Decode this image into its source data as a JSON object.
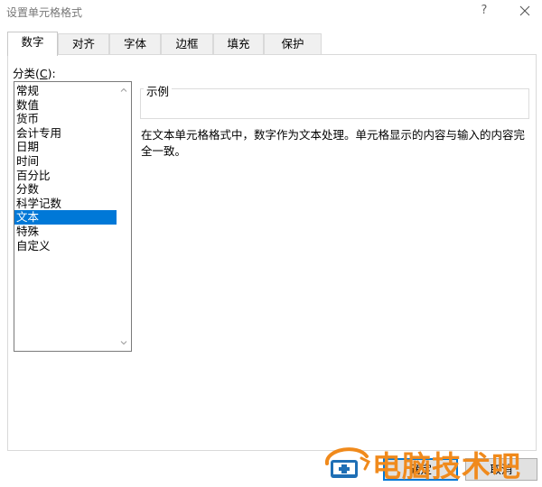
{
  "dialog": {
    "title": "设置单元格格式",
    "help_label": "?",
    "tabs": [
      {
        "label": "数字",
        "active": true
      },
      {
        "label": "对齐",
        "active": false
      },
      {
        "label": "字体",
        "active": false
      },
      {
        "label": "边框",
        "active": false
      },
      {
        "label": "填充",
        "active": false
      },
      {
        "label": "保护",
        "active": false
      }
    ]
  },
  "category": {
    "label_prefix": "分类(",
    "label_hotkey": "C",
    "label_suffix": "):",
    "items": [
      "常规",
      "数值",
      "货币",
      "会计专用",
      "日期",
      "时间",
      "百分比",
      "分数",
      "科学记数",
      "文本",
      "特殊",
      "自定义"
    ],
    "selected": "文本"
  },
  "sample": {
    "label": "示例",
    "value": ""
  },
  "description": "在文本单元格格式中，数字作为文本处理。单元格显示的内容与输入的内容完全一致。",
  "buttons": {
    "ok": "确定",
    "cancel": "取消"
  },
  "watermark": {
    "text": "电脑技术吧"
  },
  "colors": {
    "selection": "#0078d7",
    "watermark": "#f08a1c",
    "watermark_blue": "#1f6fb5"
  }
}
